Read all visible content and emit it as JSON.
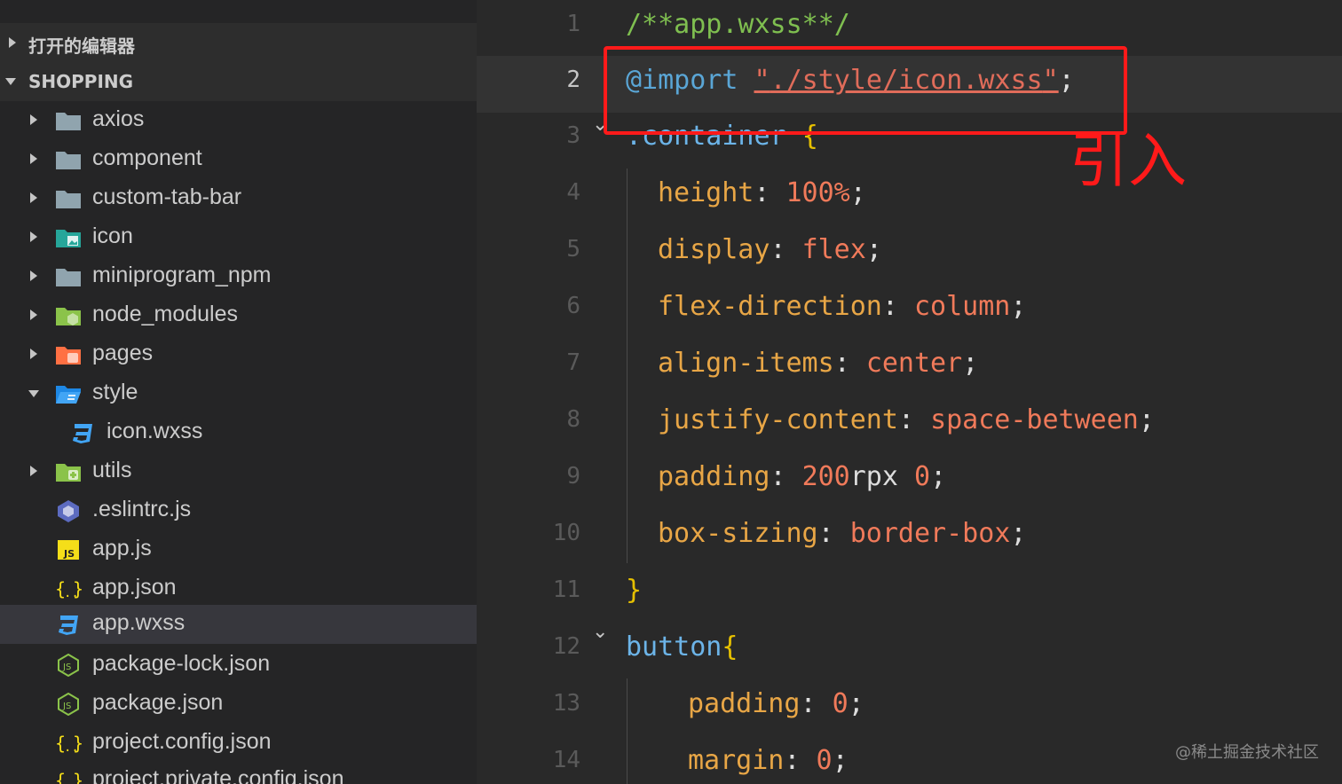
{
  "explorer": {
    "open_editors_label": "打开的编辑器",
    "project_label": "SHOPPING",
    "items": [
      {
        "name": "axios",
        "type": "folder",
        "color": "#90a4ae"
      },
      {
        "name": "component",
        "type": "folder",
        "color": "#90a4ae"
      },
      {
        "name": "custom-tab-bar",
        "type": "folder",
        "color": "#90a4ae"
      },
      {
        "name": "icon",
        "type": "folder-image",
        "color": "#26a69a"
      },
      {
        "name": "miniprogram_npm",
        "type": "folder",
        "color": "#90a4ae"
      },
      {
        "name": "node_modules",
        "type": "folder-node",
        "color": "#8bc34a"
      },
      {
        "name": "pages",
        "type": "folder-pages",
        "color": "#ff7043"
      },
      {
        "name": "style",
        "type": "folder-open",
        "color": "#42a5f5"
      },
      {
        "name": "icon.wxss",
        "type": "css",
        "color": "#42a5f5"
      },
      {
        "name": "utils",
        "type": "folder-utils",
        "color": "#8bc34a"
      },
      {
        "name": ".eslintrc.js",
        "type": "eslint",
        "color": "#5c6bc0"
      },
      {
        "name": "app.js",
        "type": "js",
        "color": "#f5de19"
      },
      {
        "name": "app.json",
        "type": "json",
        "color": "#f5de19"
      },
      {
        "name": "app.wxss",
        "type": "css",
        "color": "#42a5f5"
      },
      {
        "name": "package-lock.json",
        "type": "node",
        "color": "#8bc34a"
      },
      {
        "name": "package.json",
        "type": "node",
        "color": "#8bc34a"
      },
      {
        "name": "project.config.json",
        "type": "json",
        "color": "#f5de19"
      },
      {
        "name": "project.private.config.json",
        "type": "json",
        "color": "#f5de19"
      }
    ]
  },
  "editor": {
    "lines": [
      {
        "n": "1"
      },
      {
        "n": "2"
      },
      {
        "n": "3"
      },
      {
        "n": "4"
      },
      {
        "n": "5"
      },
      {
        "n": "6"
      },
      {
        "n": "7"
      },
      {
        "n": "8"
      },
      {
        "n": "9"
      },
      {
        "n": "10"
      },
      {
        "n": "11"
      },
      {
        "n": "12"
      },
      {
        "n": "13"
      },
      {
        "n": "14"
      }
    ],
    "code": {
      "l1_comment": "/**app.wxss**/",
      "l2_at": "@import",
      "l2_q1": "\"",
      "l2_path": "./style/icon.wxss",
      "l2_q2": "\"",
      "l2_semi": ";",
      "l3_sel": ".container",
      "l3_brace": "{",
      "l4_prop": "height",
      "l4_val": "100%",
      "l5_prop": "display",
      "l5_val": "flex",
      "l6_prop": "flex-direction",
      "l6_val": "column",
      "l7_prop": "align-items",
      "l7_val": "center",
      "l8_prop": "justify-content",
      "l8_val": "space-between",
      "l9_prop": "padding",
      "l9_num": "200",
      "l9_unit": "rpx",
      "l9_num2": "0",
      "l10_prop": "box-sizing",
      "l10_val": "border-box",
      "l11_brace": "}",
      "l12_sel": "button",
      "l12_brace": "{",
      "l13_prop": "padding",
      "l13_val": "0",
      "l14_prop": "margin",
      "l14_val": "0"
    }
  },
  "annotation": {
    "text": "引入",
    "color": "#ff1a1a"
  },
  "watermark": "@稀土掘金技术社区"
}
